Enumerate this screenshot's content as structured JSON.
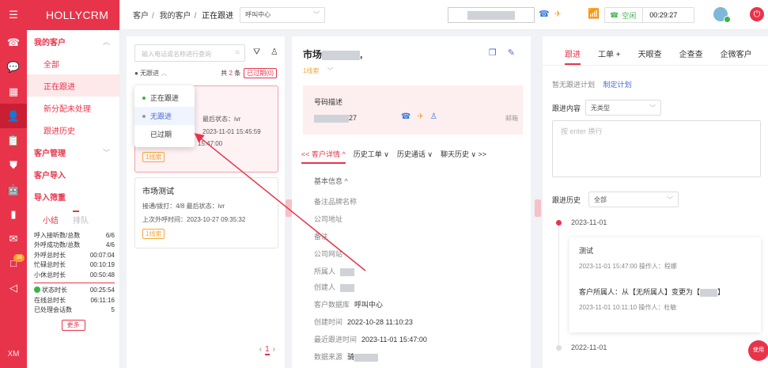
{
  "app": {
    "brand": "HOLLYCRM",
    "footer_label": "XM",
    "rail_badge": "36"
  },
  "icons": [
    "menu-icon",
    "phone-icon",
    "chat-icon",
    "grid-icon",
    "person-icon",
    "clipboard-icon",
    "shield-icon",
    "robot-icon",
    "bar-chart-icon",
    "message-icon",
    "notice-icon",
    "send-icon"
  ],
  "subnav": {
    "group1": "我的客户",
    "items": [
      "全部",
      "正在跟进",
      "新分配未处理",
      "跟进历史"
    ],
    "group2": "客户管理",
    "group3": "客户导入",
    "group4": "导入筛重",
    "stat_tab_active": "小结",
    "stat_tab_inactive": "排队",
    "stats1": [
      {
        "k": "呼入接听数/总数",
        "v": "6/6"
      },
      {
        "k": "外呼成功数/总数",
        "v": "4/6"
      },
      {
        "k": "外呼总时长",
        "v": "00:07:04"
      },
      {
        "k": "忙碌总时长",
        "v": "00:10:19"
      },
      {
        "k": "小休总时长",
        "v": "00:50:48"
      }
    ],
    "stats2": [
      {
        "k": "状态时长",
        "v": "00:25:54"
      },
      {
        "k": "在线总时长",
        "v": "06:11:16"
      },
      {
        "k": "已处理会话数",
        "v": "5"
      }
    ],
    "more": "更多"
  },
  "topbar": {
    "crumbs": [
      "客户",
      "我的客户",
      "正在跟进"
    ],
    "center_select": "呼叫中心",
    "status": "空闲",
    "timer": "00:29:27"
  },
  "list": {
    "search_placeholder": "输入电话或名称进行查询",
    "filter_label": "无跟进",
    "count_prefix": "共",
    "count_value": "2",
    "count_suffix": "条",
    "expired_tag": "已过期(0)",
    "dropdown": [
      "正在跟进",
      "无跟进",
      "已过期"
    ],
    "card1": {
      "line1_prefix": "最后状态：",
      "line1_val": "ivr",
      "time": "2023-11-01 15:45:59",
      "time2": "15:47:00",
      "tag": "1线索"
    },
    "card2": {
      "title": "市场测试",
      "line1": "接通/拨打：4/8   最后状态：ivr",
      "line2": "上次外呼时间：2023-10-27 09:35:32",
      "tag": "1线索"
    },
    "page": "1"
  },
  "detail": {
    "title_prefix": "市场",
    "title_suffix": ",",
    "sub_tag": "1线索",
    "num_label": "号码描述",
    "num_suffix": "27",
    "mail_label": "邮箱",
    "tabs": [
      "<< 客户详情 ^",
      "历史工单 ∨",
      "历史通话 ∨",
      "聊天历史 ∨ >>"
    ],
    "section": "基本信息 ^",
    "fields": [
      {
        "k": "备注品牌名称",
        "v": ""
      },
      {
        "k": "公司地址",
        "v": ""
      },
      {
        "k": "备注",
        "v": ""
      },
      {
        "k": "公司网站",
        "v": ""
      },
      {
        "k": "所属人",
        "v": ""
      },
      {
        "k": "创建人",
        "v": ""
      },
      {
        "k": "客户数据库",
        "v": "呼叫中心"
      },
      {
        "k": "创建时间",
        "v": "2022-10-28 11:10:23"
      },
      {
        "k": "最近跟进时间",
        "v": "2023-11-01 15:47:00"
      },
      {
        "k": "数据来源",
        "v": "骑"
      }
    ]
  },
  "right": {
    "tabs": [
      "跟进",
      "工单 +",
      "天眼查",
      "企查查",
      "企微客户"
    ],
    "no_plan": "暂无跟进计划",
    "make_plan": "制定计划",
    "content_label": "跟进内容",
    "content_select": "无类型",
    "textarea_placeholder": "按 enter 换行",
    "history_label": "跟进历史",
    "history_select": "全部",
    "date1": "2023-11-01",
    "entry1_title": "测试",
    "entry1_meta": "2023-11-01 15:47:00    操作人：程娜",
    "entry2_title": "客户所属人：从【无所属人】变更为【",
    "entry2_end": "】",
    "entry2_meta": "2023-11-01 10:11:10    操作人：杜敏",
    "date2": "2022-11-01",
    "float_label": "使用"
  }
}
